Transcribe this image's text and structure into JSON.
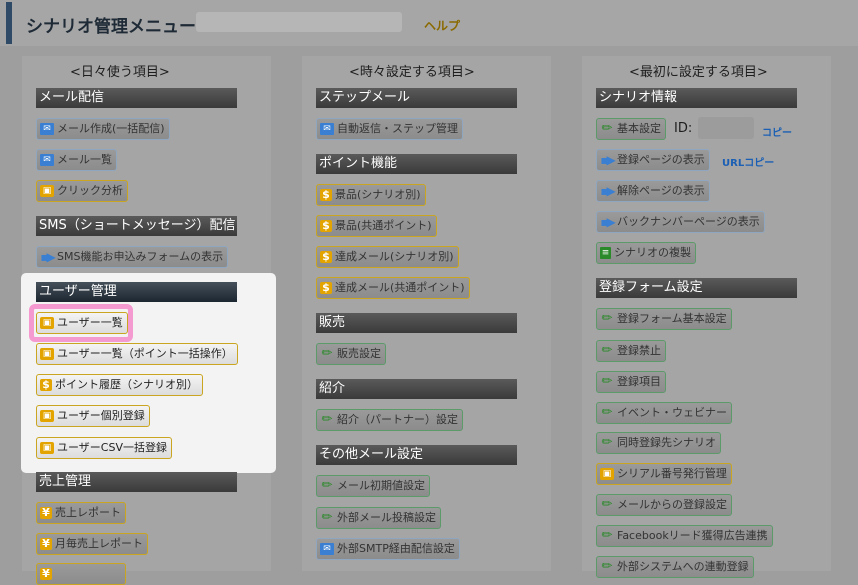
{
  "header": {
    "title": "シナリオ管理メニュー",
    "help": "ヘルプ"
  },
  "columns": [
    {
      "title": "<日々使う項目>"
    },
    {
      "title": "<時々設定する項目>"
    },
    {
      "title": "<最初に設定する項目>"
    }
  ],
  "col1": {
    "mail_section": "メール配信",
    "mail_create": "メール作成(一括配信)",
    "mail_list": "メール一覧",
    "click_analysis": "クリック分析",
    "sms_section": "SMS（ショートメッセージ）配信",
    "sms_form": "SMS機能お申込みフォームの表示",
    "user_section": "ユーザー管理",
    "user_list": "ユーザー一覧",
    "user_list_points": "ユーザー一覧（ポイント一括操作）",
    "point_history": "ポイント履歴（シナリオ別）",
    "user_register": "ユーザー個別登録",
    "user_csv": "ユーザーCSV一括登録",
    "sales_section": "売上管理",
    "sales_report": "売上レポート",
    "monthly_sales": "月毎売上レポート"
  },
  "col2": {
    "step_section": "ステップメール",
    "auto_reply": "自動返信・ステップ管理",
    "point_section": "ポイント機能",
    "prize_scenario": "景品(シナリオ別)",
    "prize_common": "景品(共通ポイント)",
    "achieve_scenario": "達成メール(シナリオ別)",
    "achieve_common": "達成メール(共通ポイント)",
    "sales_section": "販売",
    "sales_settings": "販売設定",
    "referral_section": "紹介",
    "referral_settings": "紹介（パートナー）設定",
    "other_section": "その他メール設定",
    "mail_initial": "メール初期値設定",
    "external_post": "外部メール投稿設定",
    "external_smtp": "外部SMTP経由配信設定"
  },
  "col3": {
    "scenario_section": "シナリオ情報",
    "basic_settings": "基本設定",
    "id_label": "ID:",
    "copy": "コピー",
    "show_register_page": "登録ページの表示",
    "url_copy": "URLコピー",
    "show_cancel_page": "解除ページの表示",
    "show_backnumber_page": "バックナンバーページの表示",
    "duplicate_scenario": "シナリオの複製",
    "form_section": "登録フォーム設定",
    "form_basic": "登録フォーム基本設定",
    "register_ban": "登録禁止",
    "register_items": "登録項目",
    "event_webinar": "イベント・ウェビナー",
    "simultaneous": "同時登録先シナリオ",
    "serial_number": "シリアル番号発行管理",
    "register_from_mail": "メールからの登録設定",
    "facebook_ads": "Facebookリード獲得広告連携",
    "external_system": "外部システムへの連動登録"
  }
}
